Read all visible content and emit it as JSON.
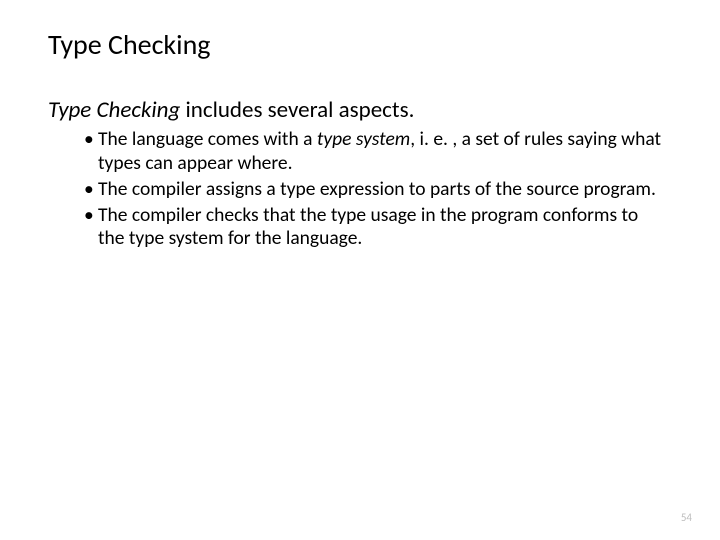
{
  "title": "Type Checking",
  "lead": {
    "italic": "Type Checking",
    "rest": " includes several aspects."
  },
  "bullets": [
    {
      "pre": "The language comes with a ",
      "em": "type system",
      "post": ", i. e. , a set of rules saying what types can appear where."
    },
    {
      "pre": "The compiler assigns a type expression to parts of the source program.",
      "em": "",
      "post": ""
    },
    {
      "pre": "The compiler checks that the type usage in the program conforms to the type system for the language.",
      "em": "",
      "post": ""
    }
  ],
  "page_number": "54"
}
